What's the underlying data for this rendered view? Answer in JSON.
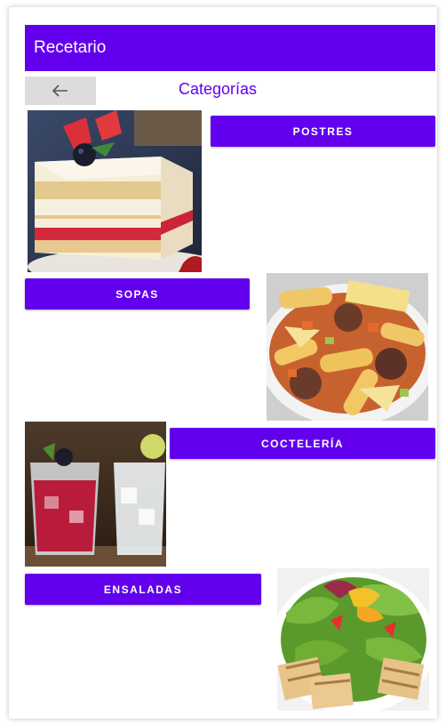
{
  "app": {
    "title": "Recetario"
  },
  "header": {
    "back_icon": "arrow-left-icon",
    "page_title": "Categorías"
  },
  "categories": [
    {
      "label": "POSTRES",
      "image": "cake-dessert-image"
    },
    {
      "label": "SOPAS",
      "image": "pasta-soup-image"
    },
    {
      "label": "COCTELERÍA",
      "image": "cocktail-drinks-image"
    },
    {
      "label": "ENSALADAS",
      "image": "salad-image"
    }
  ],
  "colors": {
    "primary": "#6200ee",
    "back_button_bg": "#dcdcdc",
    "on_primary": "#ffffff"
  }
}
